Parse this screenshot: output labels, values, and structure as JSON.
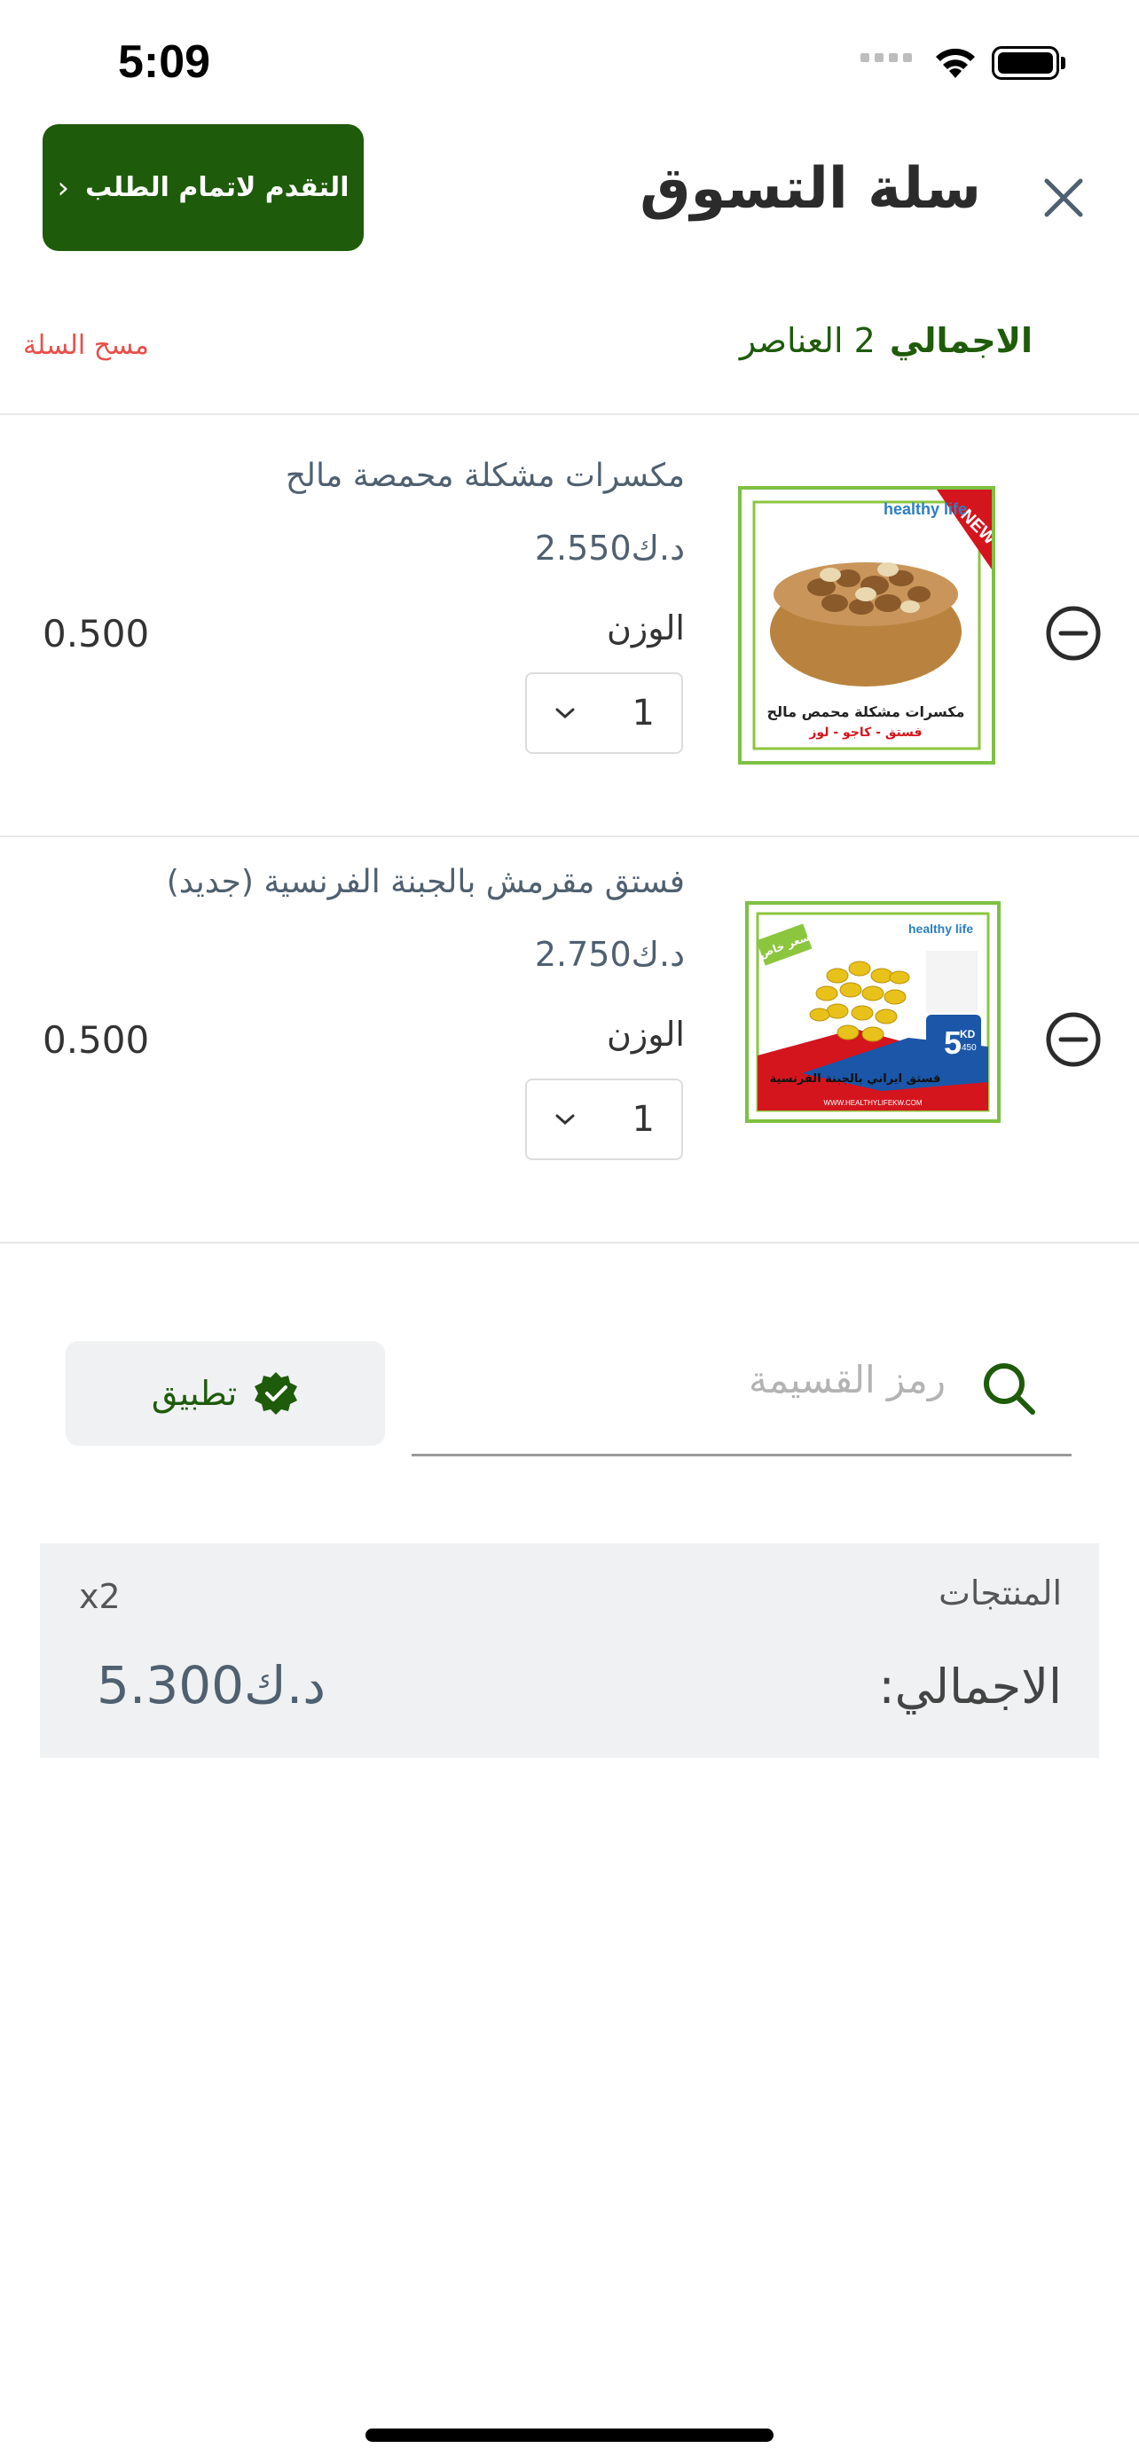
{
  "status_bar": {
    "time": "5:09"
  },
  "header": {
    "title": "سلة التسوق",
    "checkout_label": "التقدم لاتمام الطلب"
  },
  "summary": {
    "total_label": "الاجمالي",
    "items_count": "2 العناصر",
    "clear_cart_label": "مسح السلة"
  },
  "items": [
    {
      "name": "مكسرات مشكلة محمصة مالح",
      "price": "د.ك2.550",
      "weight_label": "الوزن",
      "weight_value": "0.500",
      "quantity": "1",
      "image_text": "مكسرات مشكلة محمص مالح",
      "image_subtext": "فستق - كاجو - لوز",
      "badge": "NEW !",
      "brand": "healthy life"
    },
    {
      "name": "فستق مقرمش بالجبنة الفرنسية (جديد)",
      "price": "د.ك2.750",
      "weight_label": "الوزن",
      "weight_value": "0.500",
      "quantity": "1",
      "image_text": "فستق ايراني بالجبنة الفرنسية",
      "badge": "سعر خاص",
      "brand": "healthy life",
      "price_tag": "5",
      "price_tag_unit": "KD",
      "price_tag_weight": "450",
      "website": "WWW.HEALTHYLIFEKW.COM"
    }
  ],
  "coupon": {
    "placeholder": "رمز القسيمة",
    "apply_label": "تطبيق"
  },
  "totals": {
    "products_label": "المنتجات",
    "products_count": "x2",
    "total_label": "الاجمالي:",
    "total_value": "د.ك5.300"
  },
  "colors": {
    "brand_green": "#1e5b0a",
    "danger_red": "#e8504a",
    "text_slate": "#4f6070",
    "panel_gray": "#f0f1f2"
  },
  "icons": [
    "close-icon",
    "chevron-left-icon",
    "minus-circle-icon",
    "chevron-down-icon",
    "search-icon",
    "verified-check-icon"
  ]
}
